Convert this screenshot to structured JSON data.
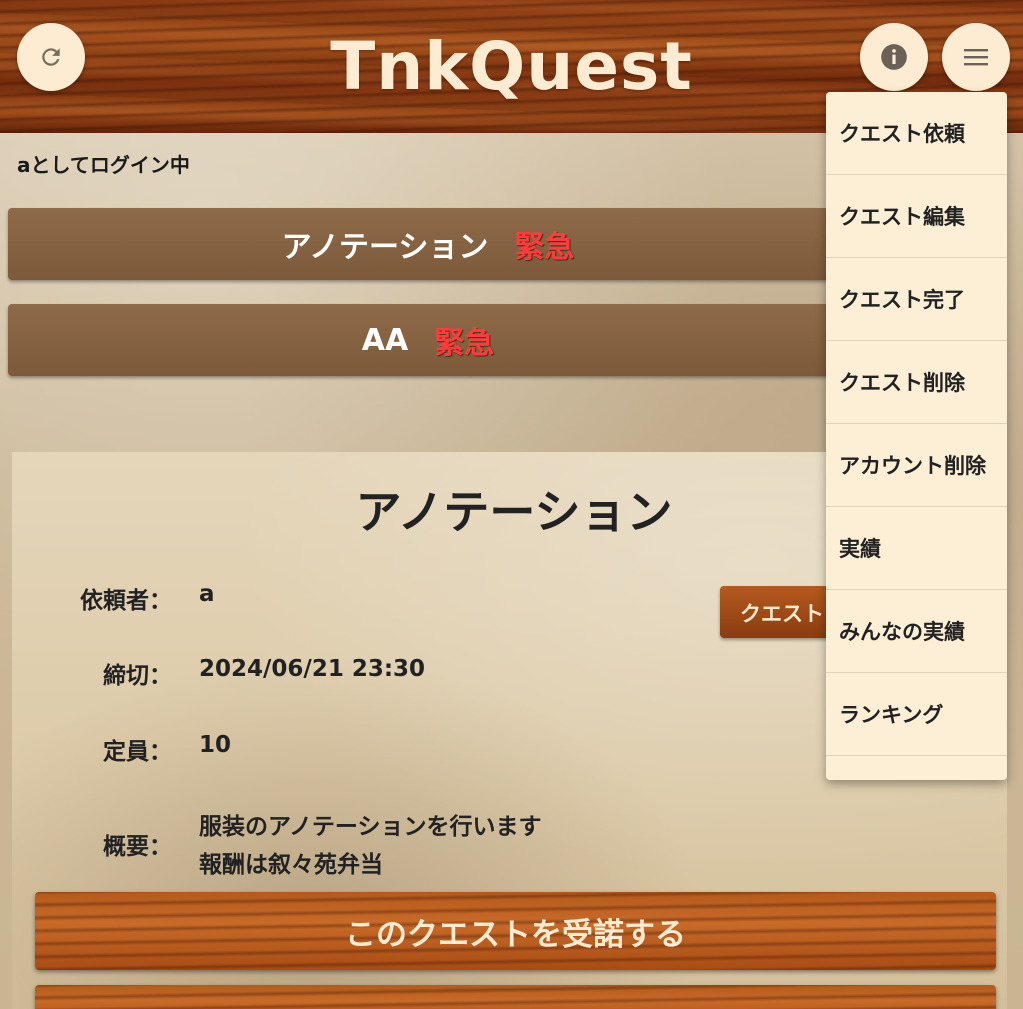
{
  "header": {
    "title": "TnkQuest",
    "refresh_icon": "refresh-icon",
    "info_icon": "info-icon",
    "menu_icon": "hamburger-menu-icon"
  },
  "user": {
    "login_status": "aとしてログイン中"
  },
  "quest_list": [
    {
      "name": "アノテーション",
      "badge": "緊急"
    },
    {
      "name": "AA",
      "badge": "緊急"
    }
  ],
  "detail": {
    "title": "アノテーション",
    "requester_label": "依頼者：",
    "requester_value": "a",
    "deadline_label": "締切：",
    "deadline_value": "2024/06/21 23:30",
    "capacity_label": "定員：",
    "capacity_value": "10",
    "summary_label": "概要：",
    "summary_line1": "服装のアノテーションを行います",
    "summary_line2": "報酬は叙々苑弁当",
    "tag_button": "クエスト",
    "accept_button": "このクエストを受諾する"
  },
  "menu": {
    "items": [
      "クエスト依頼",
      "クエスト編集",
      "クエスト完了",
      "クエスト削除",
      "アカウント削除",
      "実績",
      "みんなの実績",
      "ランキング"
    ]
  },
  "colors": {
    "urgent": "#ff3b3b",
    "cream": "#fdecd2",
    "wood": "#8a3a12"
  }
}
